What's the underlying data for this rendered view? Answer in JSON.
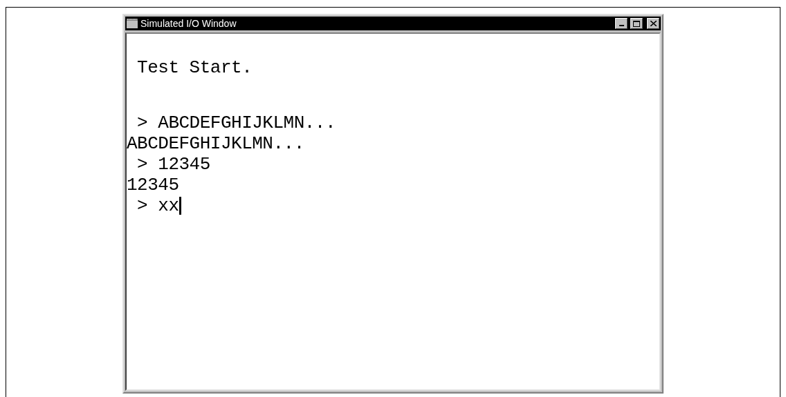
{
  "window": {
    "title": "Simulated I/O Window"
  },
  "blocks": [
    {
      "lines": [
        {
          "text": " Test Start.",
          "cursor": false
        }
      ]
    },
    {
      "lines": [
        {
          "text": " > ABCDEFGHIJKLMN...",
          "cursor": false
        },
        {
          "text": "ABCDEFGHIJKLMN...",
          "cursor": false
        },
        {
          "text": " > 12345",
          "cursor": false
        },
        {
          "text": "12345",
          "cursor": false
        },
        {
          "text": " > xx",
          "cursor": true
        }
      ]
    }
  ]
}
